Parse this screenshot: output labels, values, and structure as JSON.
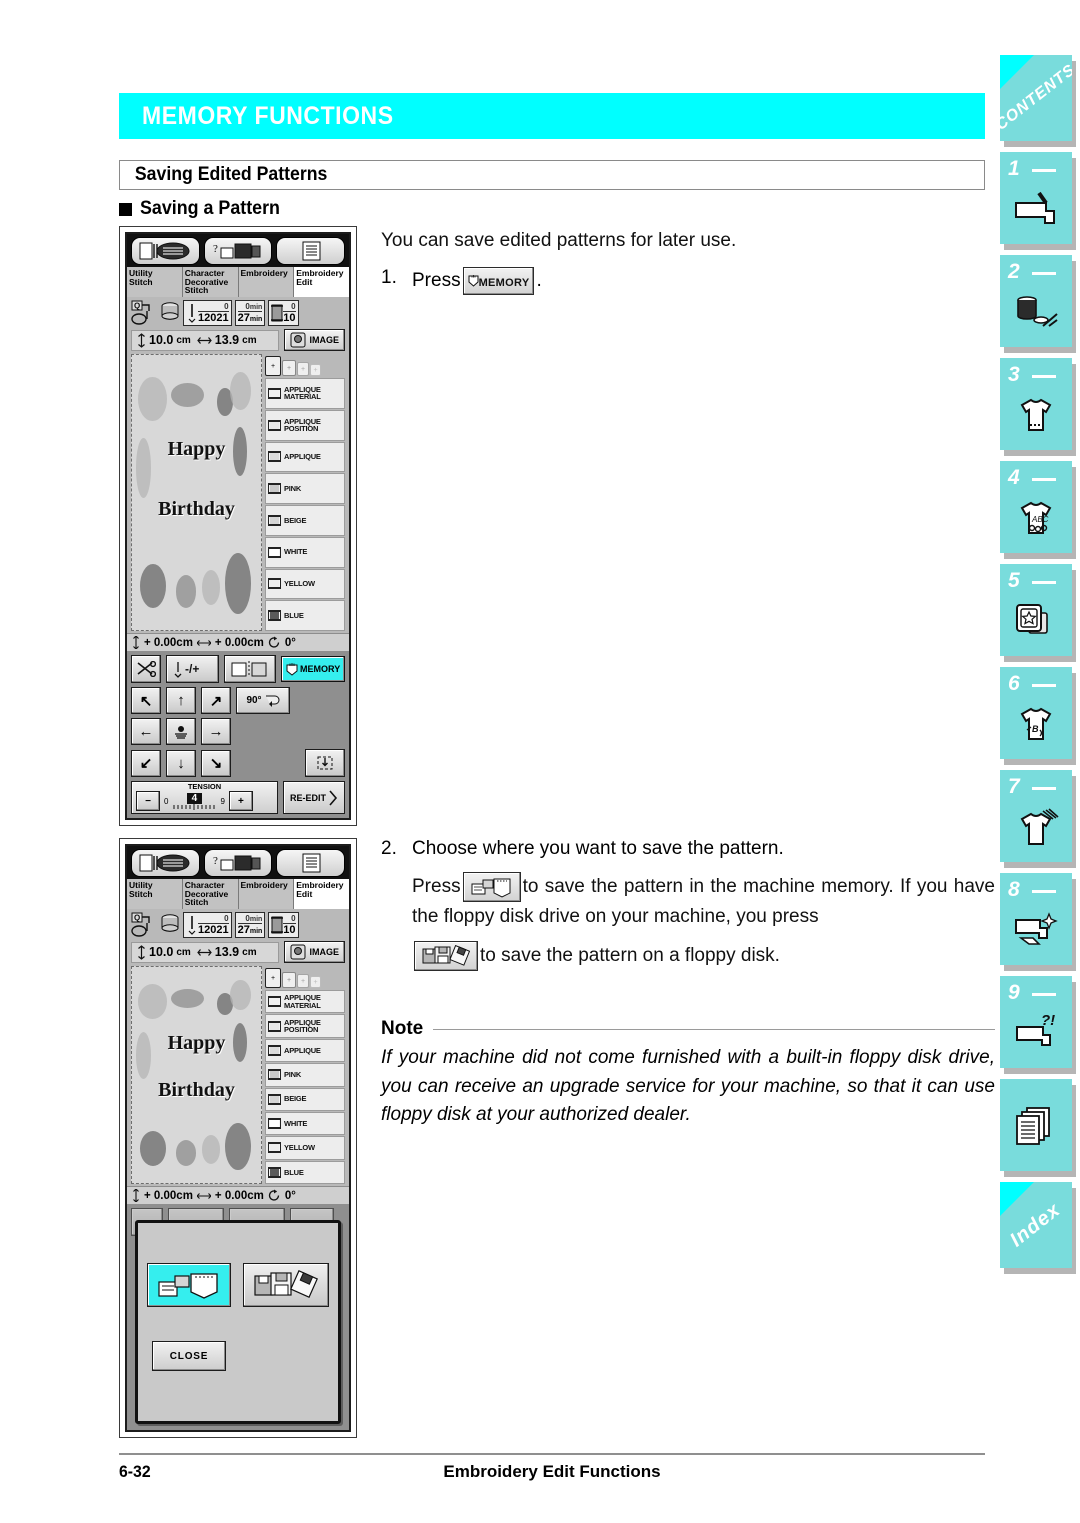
{
  "header": {
    "title": "MEMORY FUNCTIONS",
    "accent_color": "#00FFFF"
  },
  "section": {
    "title": "Saving Edited Patterns"
  },
  "subsection": {
    "title": "Saving a Pattern"
  },
  "body": {
    "intro": "You can save edited patterns for later use.",
    "step1": {
      "number": "1.",
      "text_before": "Press",
      "button_label": "MEMORY",
      "text_after": "."
    },
    "step2": {
      "number": "2.",
      "text": "Choose where you want to save the pattern.",
      "line1_before": "Press",
      "line1_after": "to save the pattern in the machine memory. If you have the floppy disk drive on your machine, you press",
      "line2_after": "to save the pattern on a floppy disk."
    }
  },
  "note": {
    "label": "Note",
    "text": "If your machine did not come furnished with a built-in floppy disk drive, you can receive an upgrade service for your machine, so that it can use floppy disk at your authorized dealer."
  },
  "lcd": {
    "mode_tabs": [
      {
        "label": "Utility\nStitch",
        "active": false
      },
      {
        "label": "Character\nDecorative\nStitch",
        "active": false
      },
      {
        "label": "Embroidery",
        "active": false
      },
      {
        "label": "Embroidery\nEdit",
        "active": true
      }
    ],
    "stats": {
      "stitch_current": "0",
      "stitch_total": "12021",
      "time_current": "0",
      "time_total": "27",
      "time_unit": "min",
      "color_current": "0",
      "color_total": "10"
    },
    "size": {
      "height": "10.0",
      "width": "13.9",
      "unit": "cm"
    },
    "image_button": "IMAGE",
    "embroidery_preview": {
      "line1": "Happy",
      "line2": "Birthday"
    },
    "colors": [
      {
        "name": "APPLIQUE MATERIAL",
        "swatch": "#f0f0f0"
      },
      {
        "name": "APPLIQUE POSITION",
        "swatch": "#e8e8e8"
      },
      {
        "name": "APPLIQUE",
        "swatch": "#dcdcdc"
      },
      {
        "name": "PINK",
        "swatch": "#c9c9c9"
      },
      {
        "name": "BEIGE",
        "swatch": "#d5d5d5"
      },
      {
        "name": "WHITE",
        "swatch": "#ffffff"
      },
      {
        "name": "YELLOW",
        "swatch": "#ededed"
      },
      {
        "name": "BLUE",
        "swatch": "#5a5a5a"
      }
    ],
    "coords": {
      "vertical": "+  0.00cm",
      "horizontal": "+  0.00cm",
      "rotation": "0°"
    },
    "tools": {
      "rotate_label": "90°",
      "memory_label": "MEMORY",
      "tension_label": "TENSION",
      "tension_min": "0",
      "tension_max": "9",
      "tension_value": "4",
      "minus": "−",
      "plus": "+",
      "reedit_label": "RE-EDIT"
    },
    "dialog": {
      "machine_memory_button": "save-to-machine-memory",
      "floppy_button": "save-to-floppy-disk",
      "close_label": "CLOSE"
    }
  },
  "tabstrip": [
    {
      "id": "contents",
      "label": "CONTENTS",
      "type": "text"
    },
    {
      "id": "ch1",
      "label": "1",
      "type": "num",
      "icon": "sewing-machine-icon"
    },
    {
      "id": "ch2",
      "label": "2",
      "type": "num",
      "icon": "spool-scissors-icon"
    },
    {
      "id": "ch3",
      "label": "3",
      "type": "num",
      "icon": "tshirt-stitch-icon"
    },
    {
      "id": "ch4",
      "label": "4",
      "type": "num",
      "icon": "tshirt-abc-icon"
    },
    {
      "id": "ch5",
      "label": "5",
      "type": "num",
      "icon": "embroidery-card-star-icon"
    },
    {
      "id": "ch6",
      "label": "6",
      "type": "num",
      "icon": "tshirt-letters-icon"
    },
    {
      "id": "ch7",
      "label": "7",
      "type": "num",
      "icon": "tshirt-needle-icon"
    },
    {
      "id": "ch8",
      "label": "8",
      "type": "num",
      "icon": "machine-cleaning-icon"
    },
    {
      "id": "ch9",
      "label": "9",
      "type": "num",
      "icon": "machine-question-icon"
    },
    {
      "id": "appendix",
      "label": "",
      "type": "icon",
      "icon": "pages-icon"
    },
    {
      "id": "index",
      "label": "Index",
      "type": "text"
    }
  ],
  "footer": {
    "page_number": "6-32",
    "title": "Embroidery Edit Functions"
  }
}
